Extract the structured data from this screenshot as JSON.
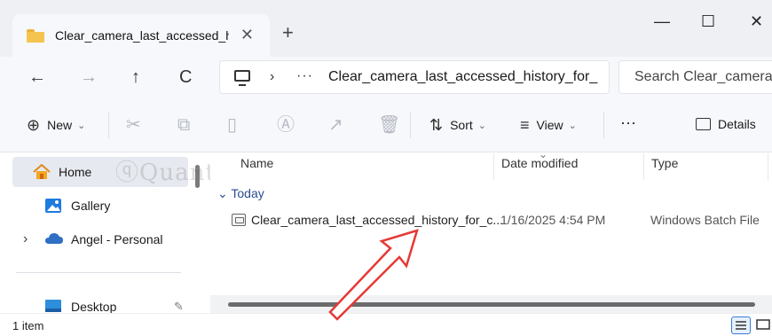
{
  "window": {
    "tab_title": "Clear_camera_last_accessed_hi",
    "tab_close_glyph": "✕",
    "new_tab_glyph": "+",
    "minimize_glyph": "—",
    "maximize_glyph": "☐",
    "close_glyph": "✕"
  },
  "nav": {
    "back_glyph": "←",
    "forward_glyph": "→",
    "up_glyph": "↑",
    "refresh_glyph": "C",
    "breadcrumb_separator": "›",
    "breadcrumb_more": "···",
    "path": "Clear_camera_last_accessed_history_for_",
    "search_placeholder": "Search Clear_camera_"
  },
  "toolbar": {
    "new_icon": "⊕",
    "new_label": "New",
    "sort_icon": "⇅",
    "sort_label": "Sort",
    "view_icon": "≡",
    "view_label": "View",
    "more_glyph": "···",
    "details_icon": "details-pane-icon",
    "details_label": "Details",
    "caret": "⌄"
  },
  "sidebar": {
    "items": [
      {
        "label": "Home",
        "icon": "home-icon",
        "active": true
      },
      {
        "label": "Gallery",
        "icon": "gallery-icon",
        "active": false
      },
      {
        "label": "Angel - Personal",
        "icon": "onedrive-icon",
        "active": false,
        "expand_glyph": "›"
      },
      {
        "label": "Desktop",
        "icon": "desktop-icon",
        "active": false,
        "pinned": true
      }
    ],
    "pin_glyph": "📌"
  },
  "columns": {
    "name": "Name",
    "date_modified": "Date modified",
    "type": "Type"
  },
  "group": {
    "label": "Today",
    "chevron": "⌄"
  },
  "files": [
    {
      "name": "Clear_camera_last_accessed_history_for_c...",
      "date_modified": "1/16/2025 4:54 PM",
      "type": "Windows Batch File"
    }
  ],
  "status": {
    "count": "1 item"
  },
  "watermark": "Quantrimang",
  "colors": {
    "accent": "#3a7bd5",
    "arrow": "#e53935",
    "folder": "#f4c44f",
    "onedrive": "#2f6fc4"
  }
}
